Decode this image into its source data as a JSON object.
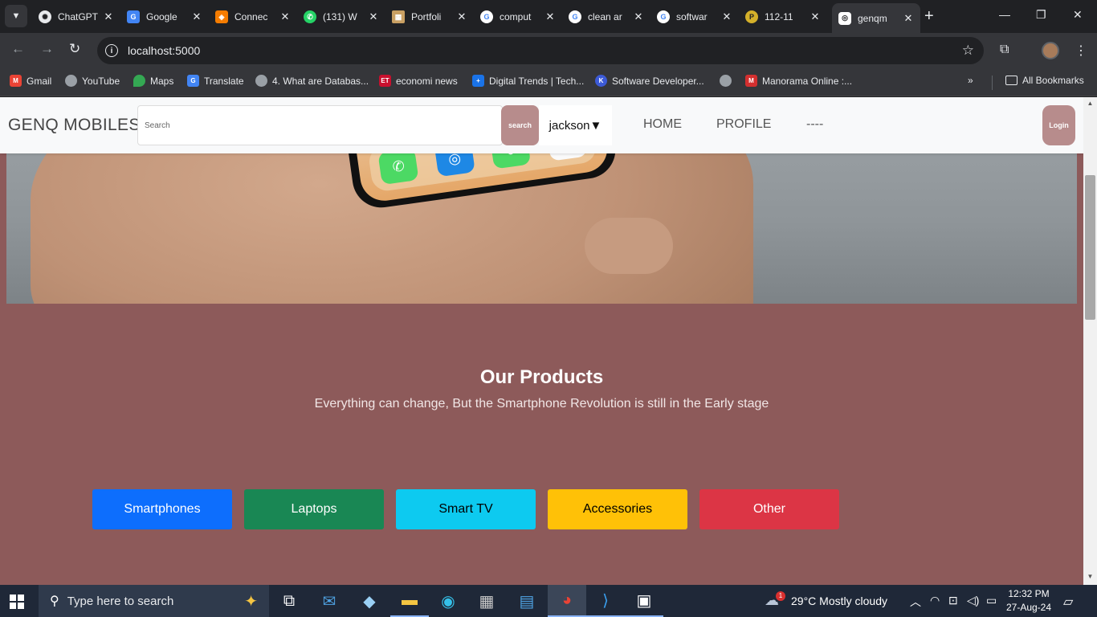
{
  "browser": {
    "tab_list_icon": "chevron-down-icon",
    "tabs": [
      {
        "title": "ChatGPT",
        "icon": "chatgpt-icon",
        "color": "#e8eaed"
      },
      {
        "title": "Google",
        "icon": "google-translate-icon",
        "color": "#4285f4"
      },
      {
        "title": "Connec",
        "icon": "connect-icon",
        "color": "#f57c00"
      },
      {
        "title": "(131) W",
        "icon": "whatsapp-icon",
        "color": "#25d366"
      },
      {
        "title": "Portfoli",
        "icon": "portfolio-icon",
        "color": "#c9a063"
      },
      {
        "title": "comput",
        "icon": "google-icon",
        "color": "#ffffff"
      },
      {
        "title": "clean ar",
        "icon": "google-icon",
        "color": "#ffffff"
      },
      {
        "title": "softwar",
        "icon": "google-icon",
        "color": "#ffffff"
      },
      {
        "title": "112-11",
        "icon": "pdf-icon",
        "color": "#d4b02a"
      },
      {
        "title": "genqm",
        "icon": "site-icon",
        "color": "#ffffff",
        "active": true
      }
    ],
    "url": "localhost:5000",
    "bookmarks": [
      {
        "label": "Gmail",
        "icon": "gmail-icon",
        "color": "#ea4335"
      },
      {
        "label": "YouTube",
        "icon": "globe-icon",
        "color": "#9aa0a6"
      },
      {
        "label": "Maps",
        "icon": "maps-icon",
        "color": "#34a853"
      },
      {
        "label": "Translate",
        "icon": "translate-icon",
        "color": "#4285f4"
      },
      {
        "label": "4. What are Databas...",
        "icon": "globe-icon",
        "color": "#9aa0a6"
      },
      {
        "label": "economi news",
        "icon": "et-icon",
        "color": "#c8102e"
      },
      {
        "label": "Digital Trends | Tech...",
        "icon": "digital-trends-icon",
        "color": "#1a73e8"
      },
      {
        "label": "Software Developer...",
        "icon": "software-dev-icon",
        "color": "#3c5ad6"
      },
      {
        "label": "",
        "icon": "globe-icon",
        "color": "#9aa0a6"
      },
      {
        "label": "Manorama Online :...",
        "icon": "manorama-icon",
        "color": "#d32f2f"
      }
    ],
    "all_bookmarks": "All Bookmarks"
  },
  "site": {
    "brand": "GENQ MOBILES",
    "search_placeholder": "Search",
    "search_button": "search",
    "user_dropdown": "jackson▼",
    "nav": [
      "HOME",
      "PROFILE",
      "----"
    ],
    "login_button": "Login",
    "products_title": "Our Products",
    "products_subtitle": "Everything can change, But the Smartphone Revolution is still in the Early stage",
    "categories": [
      {
        "label": "Smartphones",
        "bg": "#0d6efd",
        "fg": "#ffffff"
      },
      {
        "label": "Laptops",
        "bg": "#198754",
        "fg": "#ffffff"
      },
      {
        "label": "Smart TV",
        "bg": "#0dcaf0",
        "fg": "#000000"
      },
      {
        "label": "Accessories",
        "bg": "#ffc107",
        "fg": "#000000"
      },
      {
        "label": "Other",
        "bg": "#dc3545",
        "fg": "#ffffff"
      }
    ],
    "page_bg": "#8d5a5a",
    "button_accent": "#b78c8c"
  },
  "taskbar": {
    "search_placeholder": "Type here to search",
    "weather": "29°C  Mostly cloudy",
    "weather_badge": "1",
    "time": "12:32 PM",
    "date": "27-Aug-24"
  }
}
